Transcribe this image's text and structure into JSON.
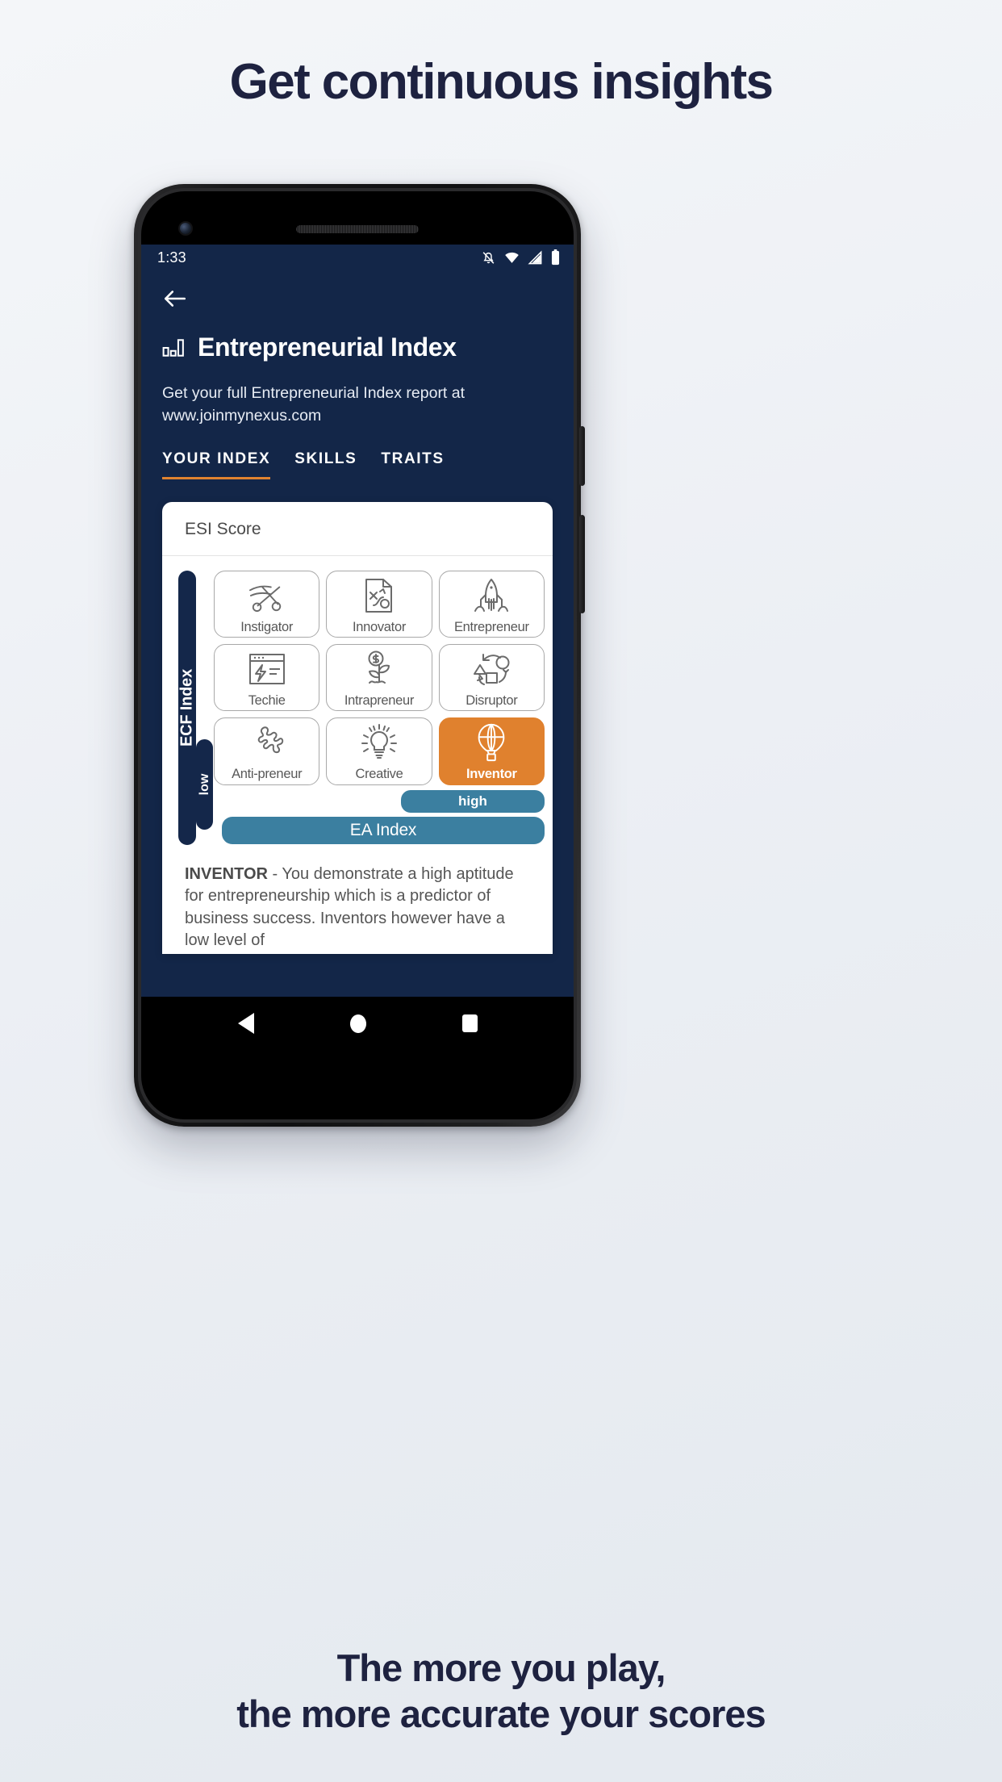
{
  "page": {
    "headline": "Get continuous insights",
    "caption_line1": "The more you play,",
    "caption_line2": "the more accurate your scores",
    "accent_navy": "#132648",
    "accent_orange": "#e0812e",
    "accent_teal": "#3b7fa0"
  },
  "status_bar": {
    "clock": "1:33",
    "icons": [
      "bell-mute-icon",
      "wifi-icon",
      "cellular-signal-icon",
      "battery-icon"
    ]
  },
  "app_bar": {
    "back_icon": "back-arrow-icon",
    "title_icon": "bar-chart-icon",
    "title": "Entrepreneurial Index",
    "subtitle": "Get your full Entrepreneurial Index report at www.joinmynexus.com"
  },
  "tabs": [
    {
      "label": "YOUR INDEX",
      "active": true
    },
    {
      "label": "SKILLS",
      "active": false
    },
    {
      "label": "TRAITS",
      "active": false
    }
  ],
  "card": {
    "title": "ESI Score",
    "axes": {
      "y_label": "ECF Index",
      "y_low": "low",
      "x_label": "EA Index",
      "x_high": "high"
    },
    "cells": [
      {
        "label": "Instigator",
        "icon": "scissors-icon",
        "active": false
      },
      {
        "label": "Innovator",
        "icon": "strategy-doc-icon",
        "active": false
      },
      {
        "label": "Entrepreneur",
        "icon": "rocket-icon",
        "active": false
      },
      {
        "label": "Techie",
        "icon": "code-window-icon",
        "active": false
      },
      {
        "label": "Intrapreneur",
        "icon": "money-plant-icon",
        "active": false
      },
      {
        "label": "Disruptor",
        "icon": "shapes-cycle-icon",
        "active": false
      },
      {
        "label": "Anti-preneur",
        "icon": "puzzle-icon",
        "active": false
      },
      {
        "label": "Creative",
        "icon": "lightbulb-icon",
        "active": false
      },
      {
        "label": "Inventor",
        "icon": "hot-air-balloon-icon",
        "active": true
      }
    ],
    "description_label": "INVENTOR",
    "description_body": " - You demonstrate a high aptitude for entrepreneurship which is a predictor of business success. Inventors however have a low level of"
  },
  "nav_bar": {
    "back": "nav-back-icon",
    "home": "nav-home-icon",
    "recents": "nav-recents-icon"
  }
}
